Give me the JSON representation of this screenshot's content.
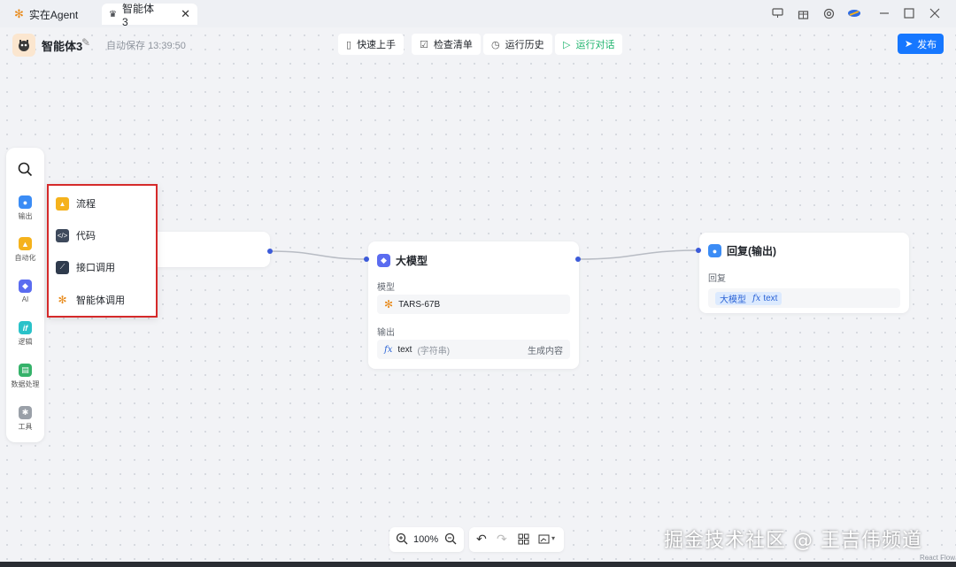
{
  "tabs": [
    {
      "label": "实在Agent",
      "icon": "pinwheel-icon"
    },
    {
      "label": "智能体3",
      "icon": "agent-icon",
      "active": true
    }
  ],
  "window_controls": [
    "monitor-icon",
    "gift-icon",
    "settings-icon",
    "brand-icon",
    "minimize-icon",
    "maximize-icon",
    "close-icon"
  ],
  "header": {
    "agent_name": "智能体3",
    "autosave": "自动保存",
    "autosave_time": "13:39:50",
    "buttons": {
      "quickstart": "快速上手",
      "checklist": "检查清单",
      "history": "运行历史",
      "run": "运行对话"
    },
    "publish": "发布"
  },
  "toolbox": {
    "items": [
      {
        "label": "输出",
        "color": "#3b8cf5"
      },
      {
        "label": "自动化",
        "color": "#f5b21c"
      },
      {
        "label": "AI",
        "color": "#5b6cf0"
      },
      {
        "label": "逻辑",
        "color": "#29c2c9"
      },
      {
        "label": "数据处理",
        "color": "#35b26a"
      },
      {
        "label": "工具",
        "color": "#9aa0a8"
      }
    ]
  },
  "submenu": {
    "items": [
      {
        "label": "流程",
        "color": "#f5b21c"
      },
      {
        "label": "代码",
        "color": "#3e4a5c"
      },
      {
        "label": "接口调用",
        "color": "#2f3b4d"
      },
      {
        "label": "智能体调用",
        "color": "#ffffff"
      }
    ]
  },
  "llm_node": {
    "title": "大模型",
    "model_label": "模型",
    "model_value": "TARS-67B",
    "output_label": "输出",
    "output_var": "text",
    "output_type": "(字符串)",
    "output_desc": "生成内容"
  },
  "reply_node": {
    "title": "回复(输出)",
    "reply_label": "回复",
    "chip_source": "大模型",
    "chip_var": "text"
  },
  "zoom": {
    "level": "100%"
  },
  "watermark": "掘金技术社区 @ 王吉伟频道",
  "footer": "React Flow"
}
